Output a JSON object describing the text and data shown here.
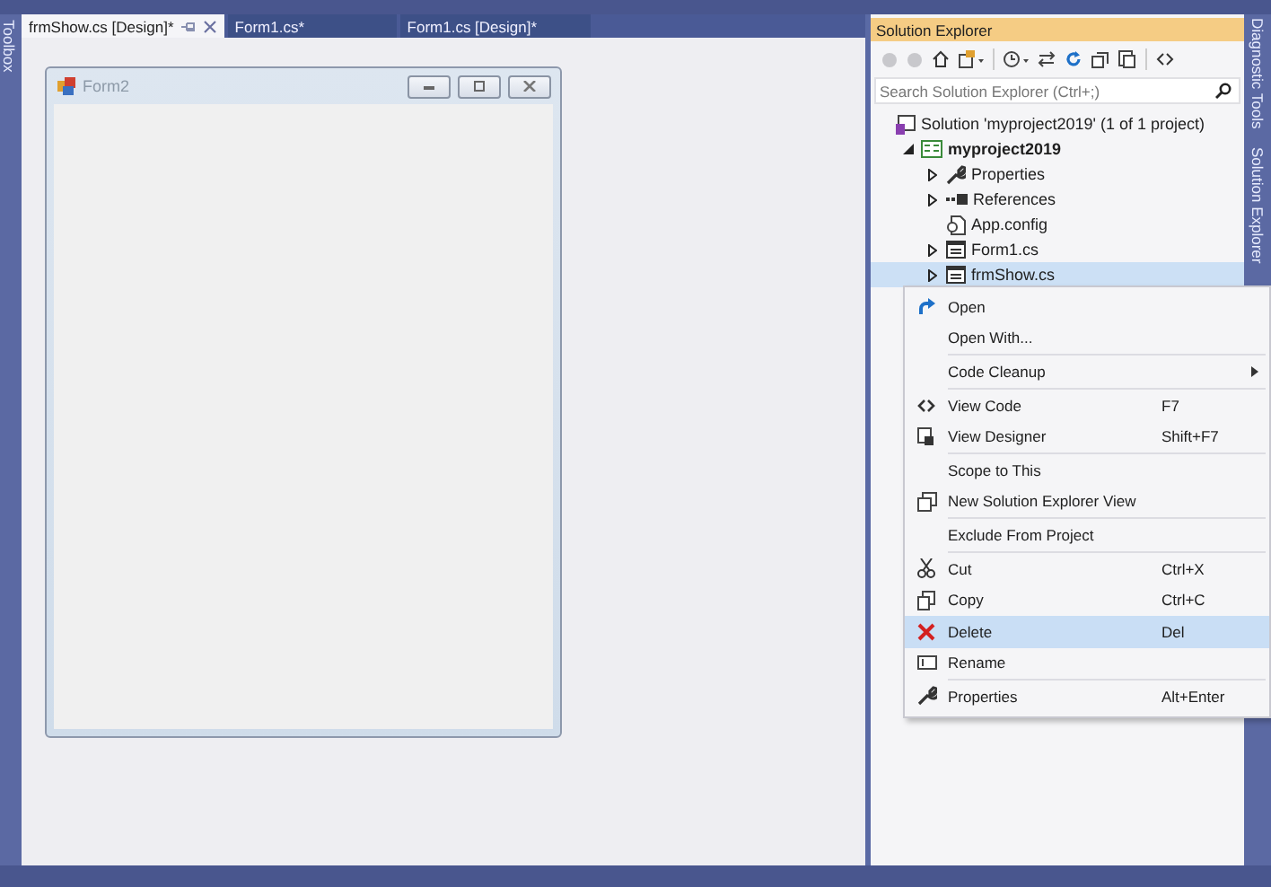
{
  "toolbox_label": "Toolbox",
  "tabs": [
    {
      "label": "frmShow.cs [Design]*",
      "selected": true
    },
    {
      "label": "Form1.cs*",
      "selected": false
    },
    {
      "label": "Form1.cs [Design]*",
      "selected": false
    }
  ],
  "designer_form": {
    "title": "Form2"
  },
  "solution_explorer": {
    "title": "Solution Explorer",
    "search": {
      "placeholder": "Search Solution Explorer (Ctrl+;)"
    },
    "tree": [
      {
        "label": "Solution 'myproject2019' (1 of 1 project)",
        "kind": "solution",
        "selected": false,
        "children": [
          {
            "label": "myproject2019",
            "kind": "project",
            "expanded": true,
            "selected": false,
            "children": [
              {
                "label": "Properties",
                "kind": "properties",
                "expanded": false,
                "selected": false
              },
              {
                "label": "References",
                "kind": "references",
                "expanded": false,
                "selected": false
              },
              {
                "label": "App.config",
                "kind": "config",
                "selected": false
              },
              {
                "label": "Form1.cs",
                "kind": "form",
                "expanded": false,
                "selected": false
              },
              {
                "label": "frmShow.cs",
                "kind": "form",
                "expanded": false,
                "selected": true
              }
            ]
          }
        ]
      }
    ]
  },
  "context_menu": {
    "items": [
      {
        "kind": "item",
        "label": "Open",
        "submenu": false,
        "selected": false
      },
      {
        "kind": "item",
        "label": "Open With...",
        "submenu": false,
        "selected": false
      },
      {
        "kind": "separator"
      },
      {
        "kind": "item",
        "label": "Code Cleanup",
        "submenu": true,
        "selected": false
      },
      {
        "kind": "separator"
      },
      {
        "kind": "item",
        "label": "View Code",
        "shortcut": "F7",
        "submenu": false,
        "selected": false
      },
      {
        "kind": "item",
        "label": "View Designer",
        "shortcut": "Shift+F7",
        "submenu": false,
        "selected": false
      },
      {
        "kind": "separator"
      },
      {
        "kind": "item",
        "label": "Scope to This",
        "submenu": false,
        "selected": false
      },
      {
        "kind": "item",
        "label": "New Solution Explorer View",
        "submenu": false,
        "selected": false
      },
      {
        "kind": "separator"
      },
      {
        "kind": "item",
        "label": "Exclude From Project",
        "submenu": false,
        "selected": false
      },
      {
        "kind": "separator"
      },
      {
        "kind": "item",
        "label": "Cut",
        "shortcut": "Ctrl+X",
        "submenu": false,
        "selected": false
      },
      {
        "kind": "item",
        "label": "Copy",
        "shortcut": "Ctrl+C",
        "submenu": false,
        "selected": false
      },
      {
        "kind": "item",
        "label": "Delete",
        "shortcut": "Del",
        "submenu": false,
        "selected": true
      },
      {
        "kind": "item",
        "label": "Rename",
        "submenu": false,
        "selected": false
      },
      {
        "kind": "separator"
      },
      {
        "kind": "item",
        "label": "Properties",
        "shortcut": "Alt+Enter",
        "submenu": false,
        "selected": false
      }
    ]
  },
  "side_tabs": [
    "Diagnostic Tools",
    "Solution Explorer"
  ]
}
